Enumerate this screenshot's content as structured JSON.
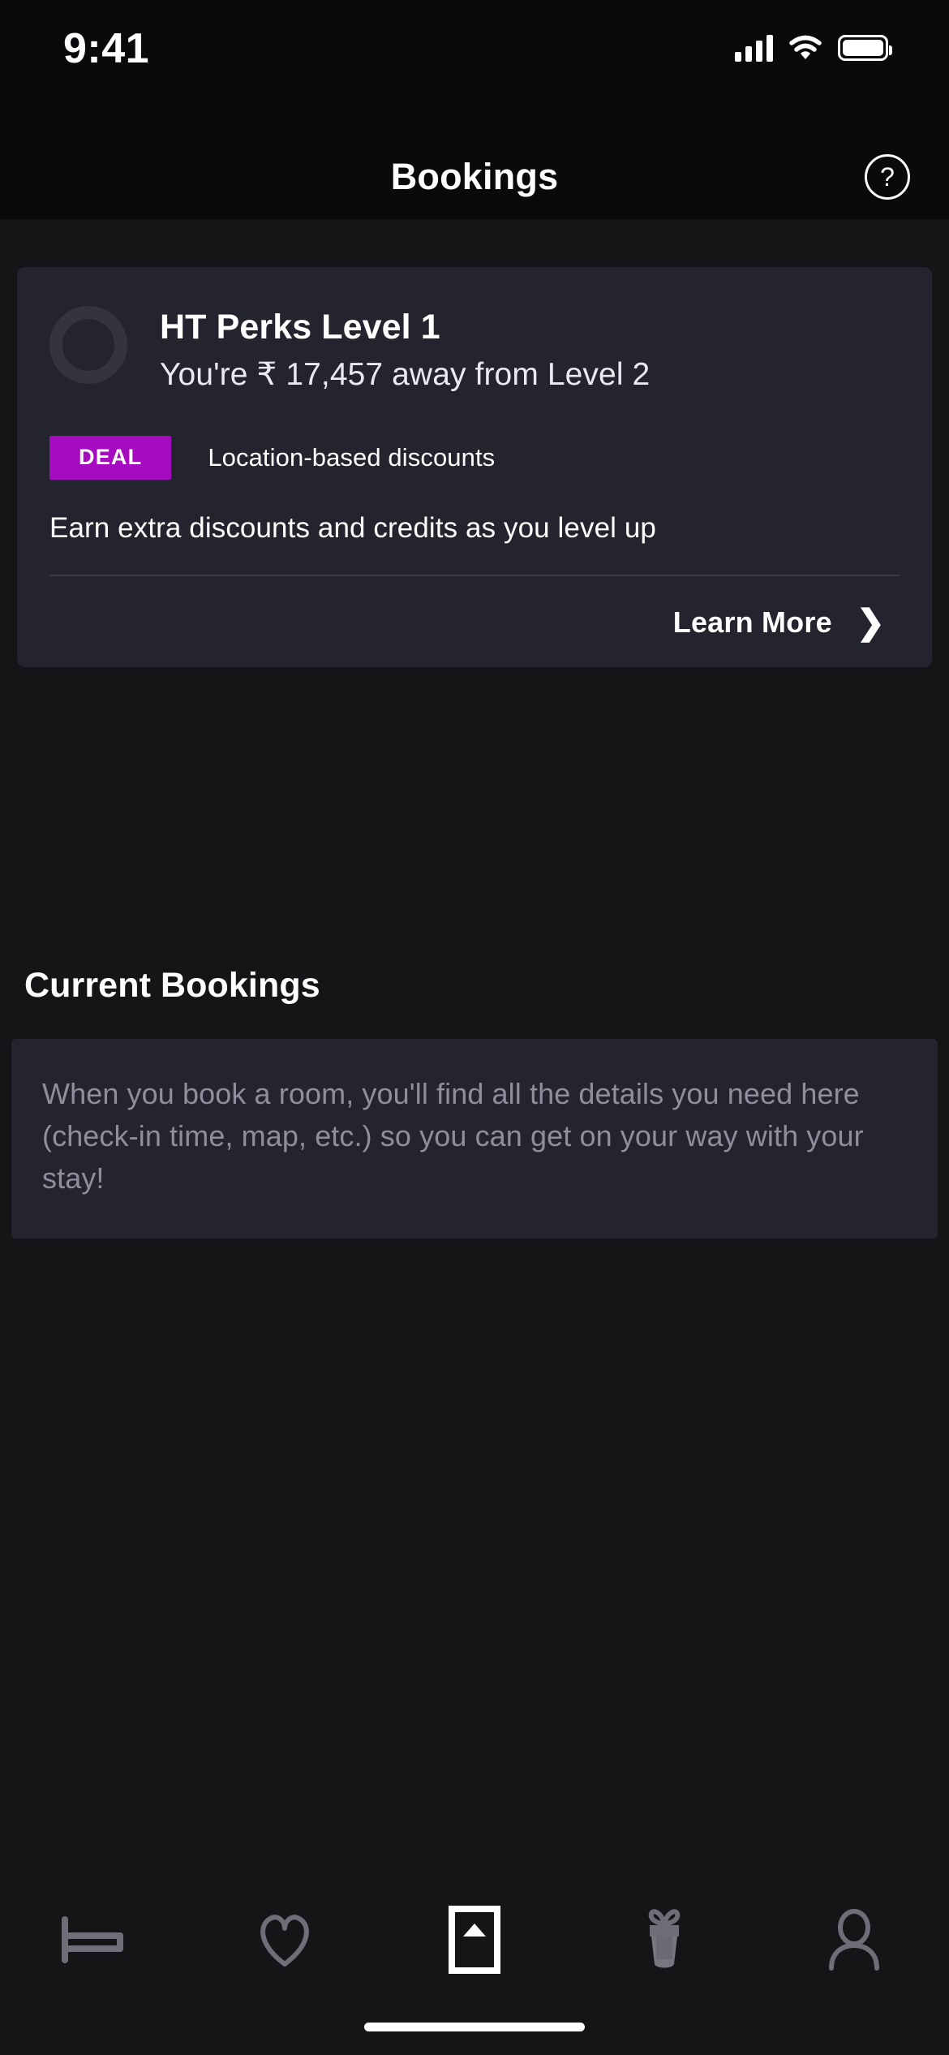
{
  "status_bar": {
    "time": "9:41",
    "cellular_icon": "signal-bars-icon",
    "wifi_icon": "wifi-icon",
    "battery_icon": "battery-full-icon"
  },
  "header": {
    "title": "Bookings",
    "help_icon": "help-circle-icon",
    "help_label": "?"
  },
  "perks_card": {
    "avatar_icon": "level-ring-icon",
    "title": "HT Perks Level 1",
    "subtitle": "You're ₹ 17,457 away from Level 2",
    "badge_label": "DEAL",
    "badge_color": "#a50bbf",
    "badge_text": "Location-based discounts",
    "description": "Earn extra discounts and credits as you level up",
    "learn_more_label": "Learn More",
    "chevron_icon": "chevron-right-icon",
    "chevron_glyph": "❯"
  },
  "current_bookings": {
    "section_title": "Current Bookings",
    "empty_message": "When you book a room, you'll find all the details you need here (check-in time, map, etc.) so you can get on your way with your stay!"
  },
  "tab_bar": {
    "items": [
      {
        "name": "stays",
        "icon": "bed-icon",
        "active": false
      },
      {
        "name": "favorites",
        "icon": "heart-icon",
        "active": false
      },
      {
        "name": "bookings",
        "icon": "boarding-pass-icon",
        "active": true
      },
      {
        "name": "rewards",
        "icon": "gift-icon",
        "active": false
      },
      {
        "name": "profile",
        "icon": "person-icon",
        "active": false
      }
    ]
  },
  "home_indicator": "home-indicator-bar",
  "colors": {
    "page_background": "#151518",
    "chrome_background": "#0a0a0c",
    "card_background": "#24242e",
    "accent": "#a50bbf",
    "muted_text": "#8e8e9c",
    "icon_inactive": "#6e6e78",
    "icon_active": "#ffffff"
  }
}
